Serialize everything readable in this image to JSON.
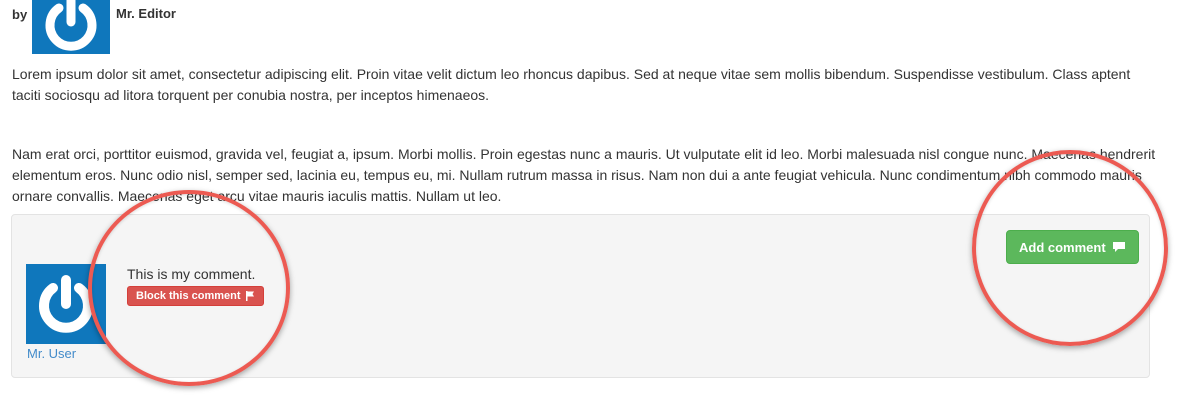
{
  "post": {
    "by_label": "by",
    "author_name": "Mr. Editor",
    "avatar_icon": "power-icon",
    "paragraphs": [
      "Lorem ipsum dolor sit amet, consectetur adipiscing elit. Proin vitae velit dictum leo rhoncus dapibus. Sed at neque vitae sem mollis bibendum. Suspendisse vestibulum. Class aptent taciti sociosqu ad litora torquent per conubia nostra, per inceptos himenaeos.",
      "Nam erat orci, porttitor euismod, gravida vel, feugiat a, ipsum. Morbi mollis. Proin egestas nunc a mauris. Ut vulputate elit id leo. Morbi malesuada nisl congue nunc. Maecenas hendrerit elementum eros. Nunc odio nisl, semper sed, lacinia eu, tempus eu, mi. Nullam rutrum massa in risus. Nam non dui a ante feugiat vehicula. Nunc condimentum nibh commodo mauris ornare convallis. Maecenas eget arcu vitae mauris iaculis mattis. Nullam ut leo."
    ]
  },
  "comments": {
    "add_button_label": "Add comment",
    "add_button_icon": "comment-icon",
    "items": [
      {
        "user_name": "Mr. User",
        "text": "This is my comment.",
        "block_button_label": "Block this comment",
        "block_button_icon": "flag-icon"
      }
    ]
  },
  "colors": {
    "avatar_bg": "#0f77bc",
    "link": "#428bca",
    "danger": "#d9534f",
    "success": "#5cb85c",
    "annotation": "#ec5a52"
  }
}
